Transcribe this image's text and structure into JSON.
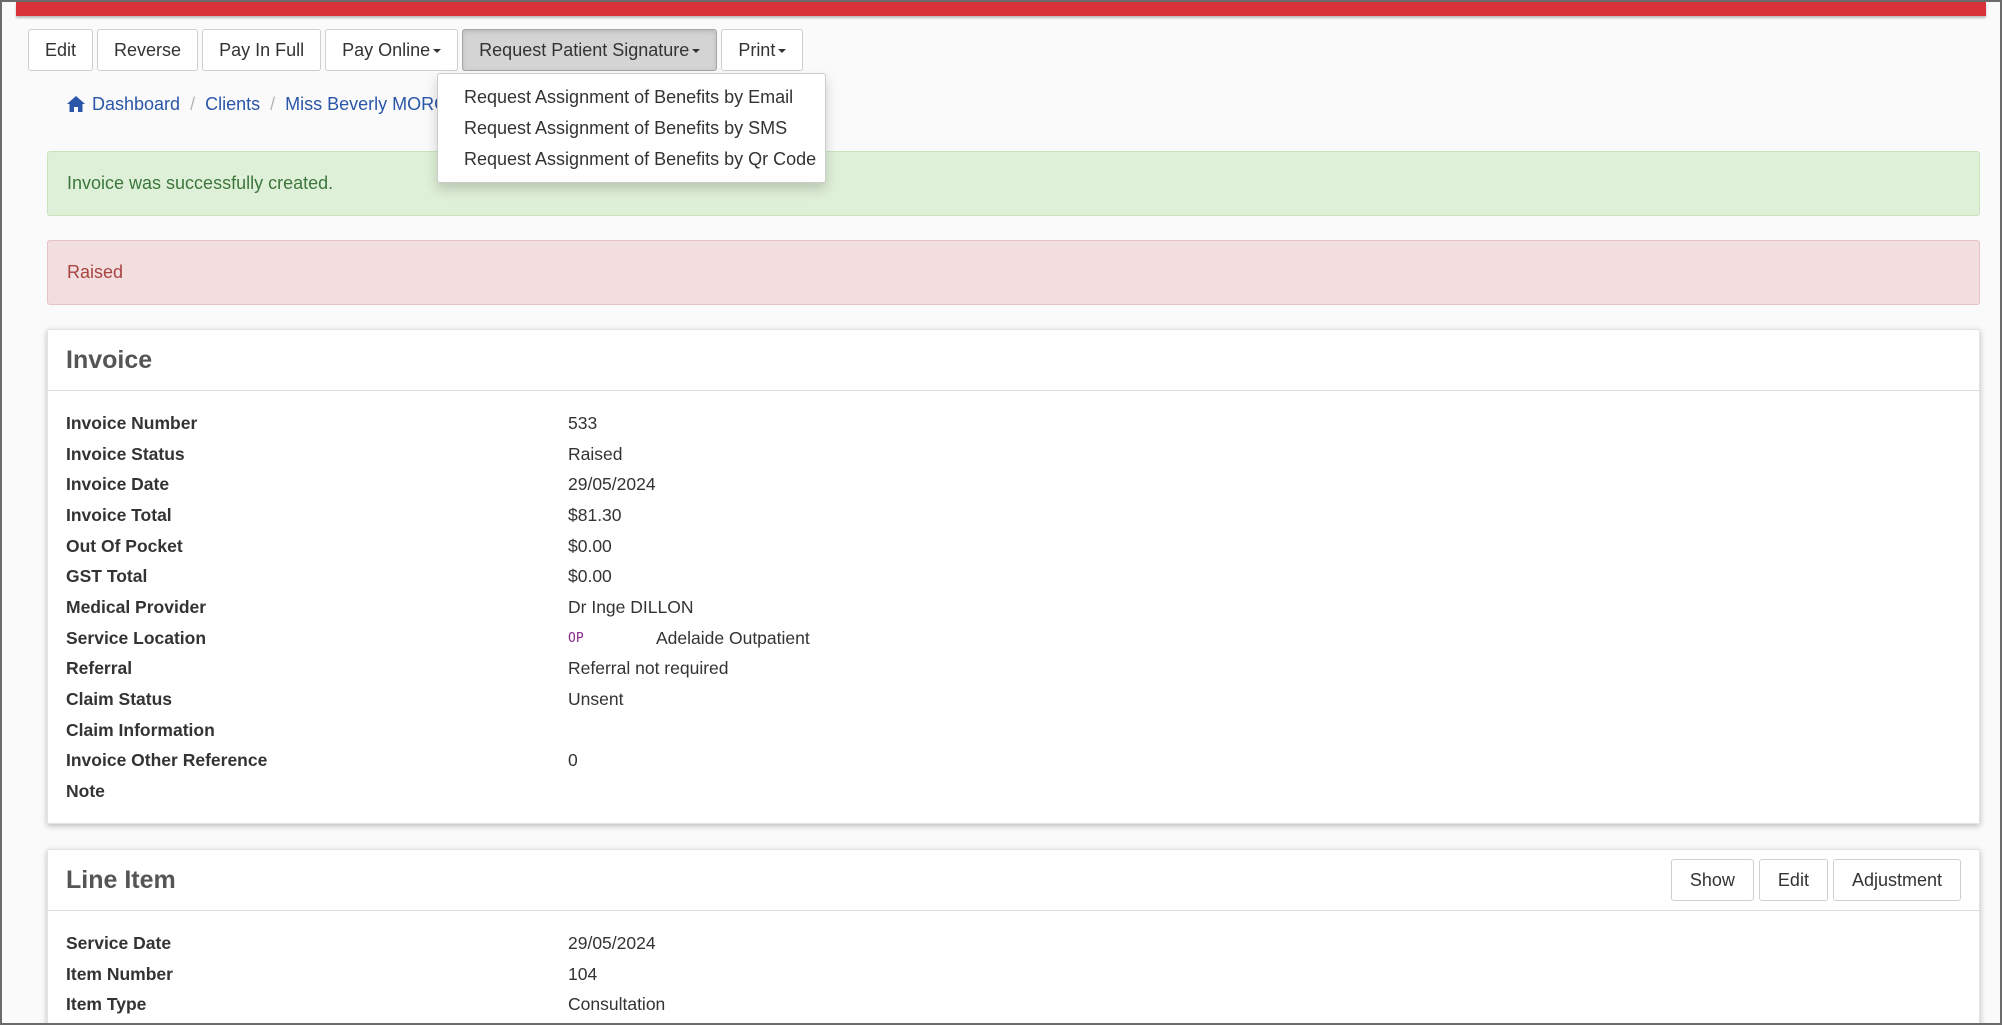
{
  "toolbar": {
    "edit": "Edit",
    "reverse": "Reverse",
    "pay_in_full": "Pay In Full",
    "pay_online": "Pay Online",
    "request_signature": "Request Patient Signature",
    "print": "Print"
  },
  "dropdown": {
    "items": [
      "Request Assignment of Benefits by Email",
      "Request Assignment of Benefits by SMS",
      "Request Assignment of Benefits by Qr Code"
    ]
  },
  "breadcrumb": {
    "dashboard": "Dashboard",
    "clients": "Clients",
    "client": "Miss Beverly MORGA"
  },
  "alerts": {
    "success": "Invoice was successfully created.",
    "status": "Raised"
  },
  "invoice": {
    "title": "Invoice",
    "rows": [
      {
        "label": "Invoice Number",
        "value": "533"
      },
      {
        "label": "Invoice Status",
        "value": "Raised"
      },
      {
        "label": "Invoice Date",
        "value": "29/05/2024"
      },
      {
        "label": "Invoice Total",
        "value": "$81.30"
      },
      {
        "label": "Out Of Pocket",
        "value": "$0.00"
      },
      {
        "label": "GST Total",
        "value": "$0.00"
      },
      {
        "label": "Medical Provider",
        "value": "Dr Inge DILLON"
      },
      {
        "label": "Service Location",
        "code": "OP",
        "value": "Adelaide Outpatient"
      },
      {
        "label": "Referral",
        "value": "Referral not required"
      },
      {
        "label": "Claim Status",
        "value": "Unsent"
      },
      {
        "label": "Claim Information",
        "value": ""
      },
      {
        "label": "Invoice Other Reference",
        "value": "0"
      },
      {
        "label": "Note",
        "value": ""
      }
    ]
  },
  "line_item": {
    "title": "Line Item",
    "actions": {
      "show": "Show",
      "edit": "Edit",
      "adjustment": "Adjustment"
    },
    "rows": [
      {
        "label": "Service Date",
        "value": "29/05/2024"
      },
      {
        "label": "Item Number",
        "value": "104"
      },
      {
        "label": "Item Type",
        "value": "Consultation"
      }
    ]
  },
  "colors": {
    "topbar": "#d83338",
    "link": "#2a56a8",
    "success_bg": "#dff0d8",
    "danger_bg": "#f2dede"
  }
}
